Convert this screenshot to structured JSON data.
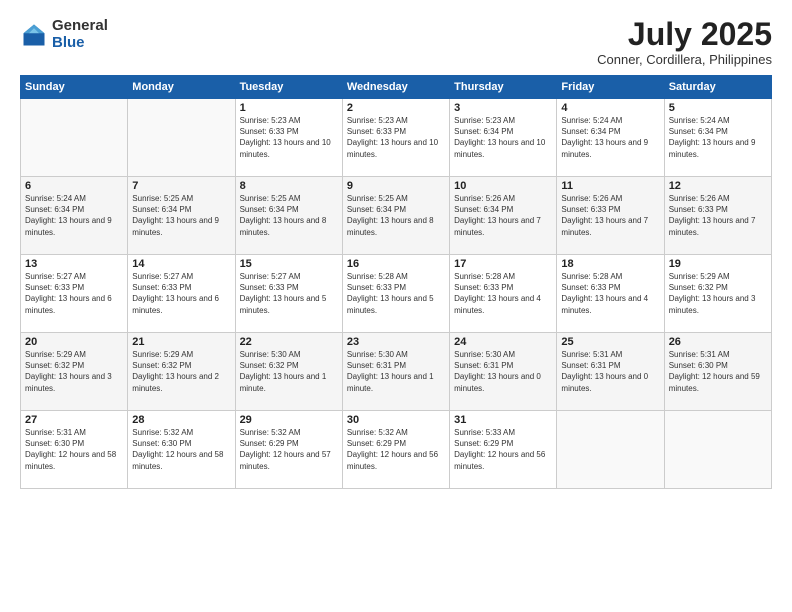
{
  "logo": {
    "general": "General",
    "blue": "Blue"
  },
  "header": {
    "month": "July 2025",
    "location": "Conner, Cordillera, Philippines"
  },
  "weekdays": [
    "Sunday",
    "Monday",
    "Tuesday",
    "Wednesday",
    "Thursday",
    "Friday",
    "Saturday"
  ],
  "weeks": [
    [
      {
        "day": "",
        "info": ""
      },
      {
        "day": "",
        "info": ""
      },
      {
        "day": "1",
        "info": "Sunrise: 5:23 AM\nSunset: 6:33 PM\nDaylight: 13 hours and 10 minutes."
      },
      {
        "day": "2",
        "info": "Sunrise: 5:23 AM\nSunset: 6:33 PM\nDaylight: 13 hours and 10 minutes."
      },
      {
        "day": "3",
        "info": "Sunrise: 5:23 AM\nSunset: 6:34 PM\nDaylight: 13 hours and 10 minutes."
      },
      {
        "day": "4",
        "info": "Sunrise: 5:24 AM\nSunset: 6:34 PM\nDaylight: 13 hours and 9 minutes."
      },
      {
        "day": "5",
        "info": "Sunrise: 5:24 AM\nSunset: 6:34 PM\nDaylight: 13 hours and 9 minutes."
      }
    ],
    [
      {
        "day": "6",
        "info": "Sunrise: 5:24 AM\nSunset: 6:34 PM\nDaylight: 13 hours and 9 minutes."
      },
      {
        "day": "7",
        "info": "Sunrise: 5:25 AM\nSunset: 6:34 PM\nDaylight: 13 hours and 9 minutes."
      },
      {
        "day": "8",
        "info": "Sunrise: 5:25 AM\nSunset: 6:34 PM\nDaylight: 13 hours and 8 minutes."
      },
      {
        "day": "9",
        "info": "Sunrise: 5:25 AM\nSunset: 6:34 PM\nDaylight: 13 hours and 8 minutes."
      },
      {
        "day": "10",
        "info": "Sunrise: 5:26 AM\nSunset: 6:34 PM\nDaylight: 13 hours and 7 minutes."
      },
      {
        "day": "11",
        "info": "Sunrise: 5:26 AM\nSunset: 6:33 PM\nDaylight: 13 hours and 7 minutes."
      },
      {
        "day": "12",
        "info": "Sunrise: 5:26 AM\nSunset: 6:33 PM\nDaylight: 13 hours and 7 minutes."
      }
    ],
    [
      {
        "day": "13",
        "info": "Sunrise: 5:27 AM\nSunset: 6:33 PM\nDaylight: 13 hours and 6 minutes."
      },
      {
        "day": "14",
        "info": "Sunrise: 5:27 AM\nSunset: 6:33 PM\nDaylight: 13 hours and 6 minutes."
      },
      {
        "day": "15",
        "info": "Sunrise: 5:27 AM\nSunset: 6:33 PM\nDaylight: 13 hours and 5 minutes."
      },
      {
        "day": "16",
        "info": "Sunrise: 5:28 AM\nSunset: 6:33 PM\nDaylight: 13 hours and 5 minutes."
      },
      {
        "day": "17",
        "info": "Sunrise: 5:28 AM\nSunset: 6:33 PM\nDaylight: 13 hours and 4 minutes."
      },
      {
        "day": "18",
        "info": "Sunrise: 5:28 AM\nSunset: 6:33 PM\nDaylight: 13 hours and 4 minutes."
      },
      {
        "day": "19",
        "info": "Sunrise: 5:29 AM\nSunset: 6:32 PM\nDaylight: 13 hours and 3 minutes."
      }
    ],
    [
      {
        "day": "20",
        "info": "Sunrise: 5:29 AM\nSunset: 6:32 PM\nDaylight: 13 hours and 3 minutes."
      },
      {
        "day": "21",
        "info": "Sunrise: 5:29 AM\nSunset: 6:32 PM\nDaylight: 13 hours and 2 minutes."
      },
      {
        "day": "22",
        "info": "Sunrise: 5:30 AM\nSunset: 6:32 PM\nDaylight: 13 hours and 1 minute."
      },
      {
        "day": "23",
        "info": "Sunrise: 5:30 AM\nSunset: 6:31 PM\nDaylight: 13 hours and 1 minute."
      },
      {
        "day": "24",
        "info": "Sunrise: 5:30 AM\nSunset: 6:31 PM\nDaylight: 13 hours and 0 minutes."
      },
      {
        "day": "25",
        "info": "Sunrise: 5:31 AM\nSunset: 6:31 PM\nDaylight: 13 hours and 0 minutes."
      },
      {
        "day": "26",
        "info": "Sunrise: 5:31 AM\nSunset: 6:30 PM\nDaylight: 12 hours and 59 minutes."
      }
    ],
    [
      {
        "day": "27",
        "info": "Sunrise: 5:31 AM\nSunset: 6:30 PM\nDaylight: 12 hours and 58 minutes."
      },
      {
        "day": "28",
        "info": "Sunrise: 5:32 AM\nSunset: 6:30 PM\nDaylight: 12 hours and 58 minutes."
      },
      {
        "day": "29",
        "info": "Sunrise: 5:32 AM\nSunset: 6:29 PM\nDaylight: 12 hours and 57 minutes."
      },
      {
        "day": "30",
        "info": "Sunrise: 5:32 AM\nSunset: 6:29 PM\nDaylight: 12 hours and 56 minutes."
      },
      {
        "day": "31",
        "info": "Sunrise: 5:33 AM\nSunset: 6:29 PM\nDaylight: 12 hours and 56 minutes."
      },
      {
        "day": "",
        "info": ""
      },
      {
        "day": "",
        "info": ""
      }
    ]
  ]
}
